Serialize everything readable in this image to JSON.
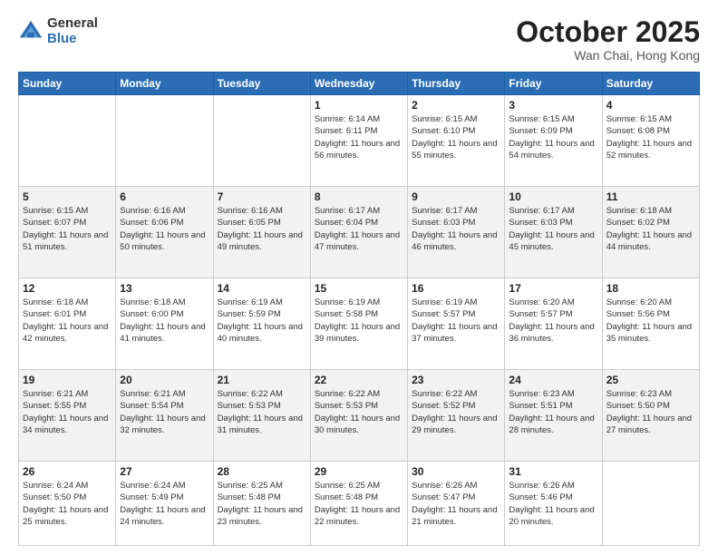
{
  "logo": {
    "general": "General",
    "blue": "Blue"
  },
  "header": {
    "month": "October 2025",
    "location": "Wan Chai, Hong Kong"
  },
  "weekdays": [
    "Sunday",
    "Monday",
    "Tuesday",
    "Wednesday",
    "Thursday",
    "Friday",
    "Saturday"
  ],
  "weeks": [
    [
      {
        "day": "",
        "sunrise": "",
        "sunset": "",
        "daylight": ""
      },
      {
        "day": "",
        "sunrise": "",
        "sunset": "",
        "daylight": ""
      },
      {
        "day": "",
        "sunrise": "",
        "sunset": "",
        "daylight": ""
      },
      {
        "day": "1",
        "sunrise": "Sunrise: 6:14 AM",
        "sunset": "Sunset: 6:11 PM",
        "daylight": "Daylight: 11 hours and 56 minutes."
      },
      {
        "day": "2",
        "sunrise": "Sunrise: 6:15 AM",
        "sunset": "Sunset: 6:10 PM",
        "daylight": "Daylight: 11 hours and 55 minutes."
      },
      {
        "day": "3",
        "sunrise": "Sunrise: 6:15 AM",
        "sunset": "Sunset: 6:09 PM",
        "daylight": "Daylight: 11 hours and 54 minutes."
      },
      {
        "day": "4",
        "sunrise": "Sunrise: 6:15 AM",
        "sunset": "Sunset: 6:08 PM",
        "daylight": "Daylight: 11 hours and 52 minutes."
      }
    ],
    [
      {
        "day": "5",
        "sunrise": "Sunrise: 6:15 AM",
        "sunset": "Sunset: 6:07 PM",
        "daylight": "Daylight: 11 hours and 51 minutes."
      },
      {
        "day": "6",
        "sunrise": "Sunrise: 6:16 AM",
        "sunset": "Sunset: 6:06 PM",
        "daylight": "Daylight: 11 hours and 50 minutes."
      },
      {
        "day": "7",
        "sunrise": "Sunrise: 6:16 AM",
        "sunset": "Sunset: 6:05 PM",
        "daylight": "Daylight: 11 hours and 49 minutes."
      },
      {
        "day": "8",
        "sunrise": "Sunrise: 6:17 AM",
        "sunset": "Sunset: 6:04 PM",
        "daylight": "Daylight: 11 hours and 47 minutes."
      },
      {
        "day": "9",
        "sunrise": "Sunrise: 6:17 AM",
        "sunset": "Sunset: 6:03 PM",
        "daylight": "Daylight: 11 hours and 46 minutes."
      },
      {
        "day": "10",
        "sunrise": "Sunrise: 6:17 AM",
        "sunset": "Sunset: 6:03 PM",
        "daylight": "Daylight: 11 hours and 45 minutes."
      },
      {
        "day": "11",
        "sunrise": "Sunrise: 6:18 AM",
        "sunset": "Sunset: 6:02 PM",
        "daylight": "Daylight: 11 hours and 44 minutes."
      }
    ],
    [
      {
        "day": "12",
        "sunrise": "Sunrise: 6:18 AM",
        "sunset": "Sunset: 6:01 PM",
        "daylight": "Daylight: 11 hours and 42 minutes."
      },
      {
        "day": "13",
        "sunrise": "Sunrise: 6:18 AM",
        "sunset": "Sunset: 6:00 PM",
        "daylight": "Daylight: 11 hours and 41 minutes."
      },
      {
        "day": "14",
        "sunrise": "Sunrise: 6:19 AM",
        "sunset": "Sunset: 5:59 PM",
        "daylight": "Daylight: 11 hours and 40 minutes."
      },
      {
        "day": "15",
        "sunrise": "Sunrise: 6:19 AM",
        "sunset": "Sunset: 5:58 PM",
        "daylight": "Daylight: 11 hours and 39 minutes."
      },
      {
        "day": "16",
        "sunrise": "Sunrise: 6:19 AM",
        "sunset": "Sunset: 5:57 PM",
        "daylight": "Daylight: 11 hours and 37 minutes."
      },
      {
        "day": "17",
        "sunrise": "Sunrise: 6:20 AM",
        "sunset": "Sunset: 5:57 PM",
        "daylight": "Daylight: 11 hours and 36 minutes."
      },
      {
        "day": "18",
        "sunrise": "Sunrise: 6:20 AM",
        "sunset": "Sunset: 5:56 PM",
        "daylight": "Daylight: 11 hours and 35 minutes."
      }
    ],
    [
      {
        "day": "19",
        "sunrise": "Sunrise: 6:21 AM",
        "sunset": "Sunset: 5:55 PM",
        "daylight": "Daylight: 11 hours and 34 minutes."
      },
      {
        "day": "20",
        "sunrise": "Sunrise: 6:21 AM",
        "sunset": "Sunset: 5:54 PM",
        "daylight": "Daylight: 11 hours and 32 minutes."
      },
      {
        "day": "21",
        "sunrise": "Sunrise: 6:22 AM",
        "sunset": "Sunset: 5:53 PM",
        "daylight": "Daylight: 11 hours and 31 minutes."
      },
      {
        "day": "22",
        "sunrise": "Sunrise: 6:22 AM",
        "sunset": "Sunset: 5:53 PM",
        "daylight": "Daylight: 11 hours and 30 minutes."
      },
      {
        "day": "23",
        "sunrise": "Sunrise: 6:22 AM",
        "sunset": "Sunset: 5:52 PM",
        "daylight": "Daylight: 11 hours and 29 minutes."
      },
      {
        "day": "24",
        "sunrise": "Sunrise: 6:23 AM",
        "sunset": "Sunset: 5:51 PM",
        "daylight": "Daylight: 11 hours and 28 minutes."
      },
      {
        "day": "25",
        "sunrise": "Sunrise: 6:23 AM",
        "sunset": "Sunset: 5:50 PM",
        "daylight": "Daylight: 11 hours and 27 minutes."
      }
    ],
    [
      {
        "day": "26",
        "sunrise": "Sunrise: 6:24 AM",
        "sunset": "Sunset: 5:50 PM",
        "daylight": "Daylight: 11 hours and 25 minutes."
      },
      {
        "day": "27",
        "sunrise": "Sunrise: 6:24 AM",
        "sunset": "Sunset: 5:49 PM",
        "daylight": "Daylight: 11 hours and 24 minutes."
      },
      {
        "day": "28",
        "sunrise": "Sunrise: 6:25 AM",
        "sunset": "Sunset: 5:48 PM",
        "daylight": "Daylight: 11 hours and 23 minutes."
      },
      {
        "day": "29",
        "sunrise": "Sunrise: 6:25 AM",
        "sunset": "Sunset: 5:48 PM",
        "daylight": "Daylight: 11 hours and 22 minutes."
      },
      {
        "day": "30",
        "sunrise": "Sunrise: 6:26 AM",
        "sunset": "Sunset: 5:47 PM",
        "daylight": "Daylight: 11 hours and 21 minutes."
      },
      {
        "day": "31",
        "sunrise": "Sunrise: 6:26 AM",
        "sunset": "Sunset: 5:46 PM",
        "daylight": "Daylight: 11 hours and 20 minutes."
      },
      {
        "day": "",
        "sunrise": "",
        "sunset": "",
        "daylight": ""
      }
    ]
  ]
}
